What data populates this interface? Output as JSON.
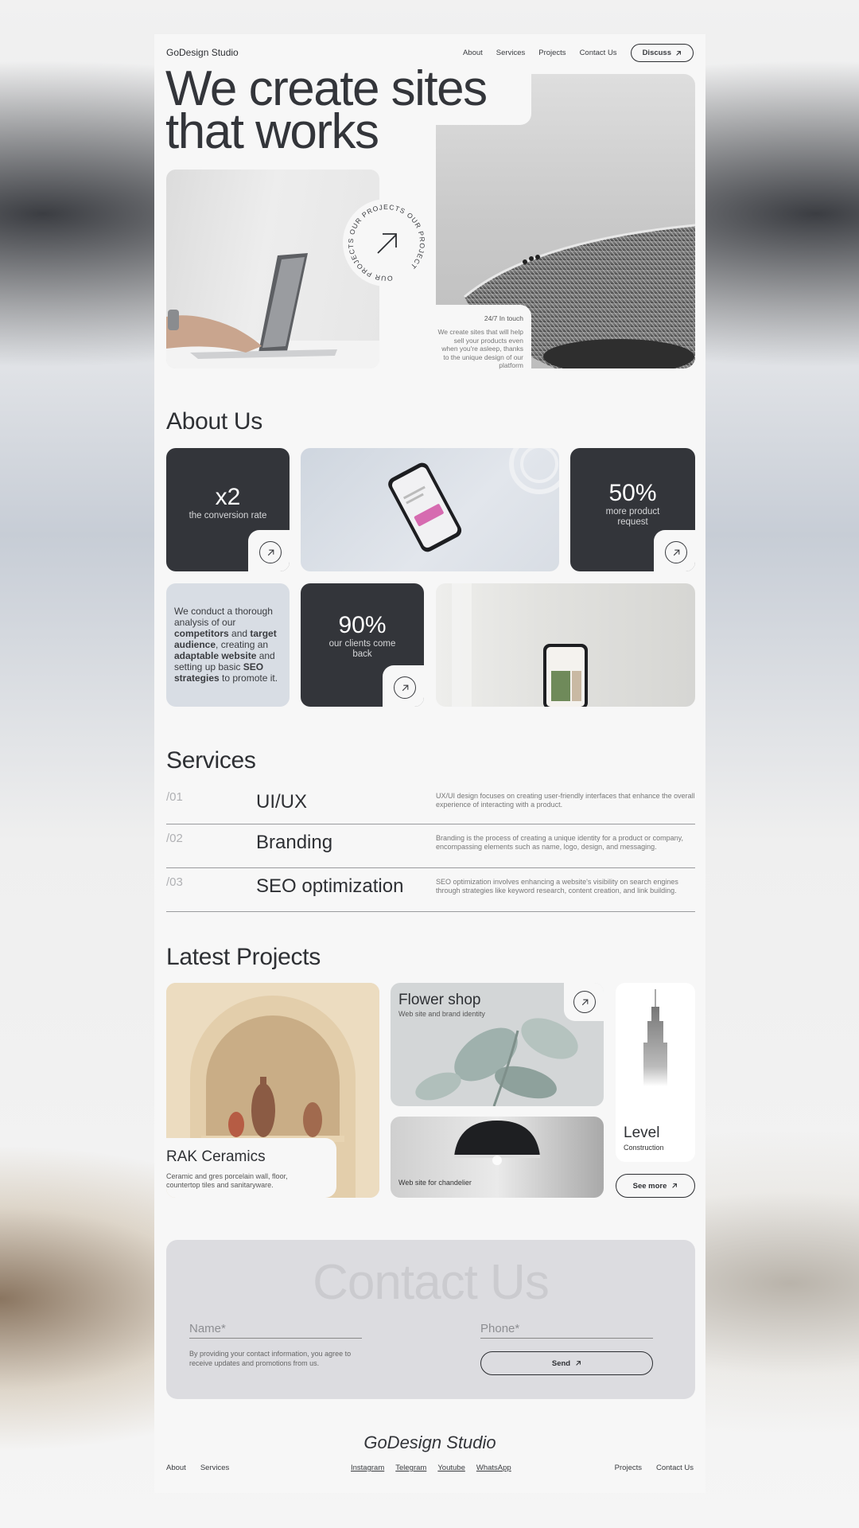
{
  "nav": {
    "brand": "GoDesign Studio",
    "links": [
      "About",
      "Services",
      "Projects",
      "Contact Us"
    ],
    "cta": "Discuss"
  },
  "hero": {
    "title_line1": "We create sites",
    "title_line2": "that works",
    "circle_text": "OUR PROJECTS OUR PROJECTS OUR PROJECT",
    "touch_label": "24/7 In touch",
    "touch_desc": "We create sites that will help sell your products even when you're asleep, thanks to the unique design of our platform"
  },
  "about": {
    "title": "About Us",
    "stat1": {
      "value": "x2",
      "label": "the conversion rate"
    },
    "stat2": {
      "value": "50%",
      "label": "more product request"
    },
    "stat3": {
      "value": "90%",
      "label": "our clients come back"
    },
    "text_parts": [
      "We conduct a thorough analysis of our ",
      "competitors",
      " and ",
      "target audience",
      ", creating an ",
      "adaptable website",
      " and setting up basic ",
      "SEO strategies",
      " to promote it."
    ]
  },
  "services": {
    "title": "Services",
    "items": [
      {
        "num": "/01",
        "name": "UI/UX",
        "desc": "UX/UI design focuses on creating user-friendly interfaces that enhance the overall experience of interacting with a product."
      },
      {
        "num": "/02",
        "name": "Branding",
        "desc": "Branding is the process of creating a unique identity for a product or company, encompassing elements such as name, logo, design, and messaging."
      },
      {
        "num": "/03",
        "name": "SEO optimization",
        "desc": "SEO optimization involves enhancing a website's visibility on search engines through strategies like keyword research, content creation, and link building."
      }
    ]
  },
  "projects": {
    "title": "Latest Projects",
    "rak": {
      "name": "RAK Ceramics",
      "desc": "Ceramic and gres porcelain wall, floor, countertop tiles and sanitaryware."
    },
    "flower": {
      "name": "Flower shop",
      "desc": "Web site and brand identity"
    },
    "lamp": {
      "desc": "Web site for chandelier"
    },
    "level": {
      "name": "Level",
      "desc": "Construction"
    },
    "see_more": "See more"
  },
  "contact": {
    "title": "Contact Us",
    "name_placeholder": "Name*",
    "phone_placeholder": "Phone*",
    "consent": "By providing your contact information, you agree to receive updates and promotions from us.",
    "send": "Send"
  },
  "footer": {
    "brand": "GoDesign Studio",
    "left": [
      "About",
      "Services"
    ],
    "social": [
      "Instagram",
      "Telegram",
      "Youtube",
      "WhatsApp"
    ],
    "right": [
      "Projects",
      "Contact Us"
    ]
  }
}
